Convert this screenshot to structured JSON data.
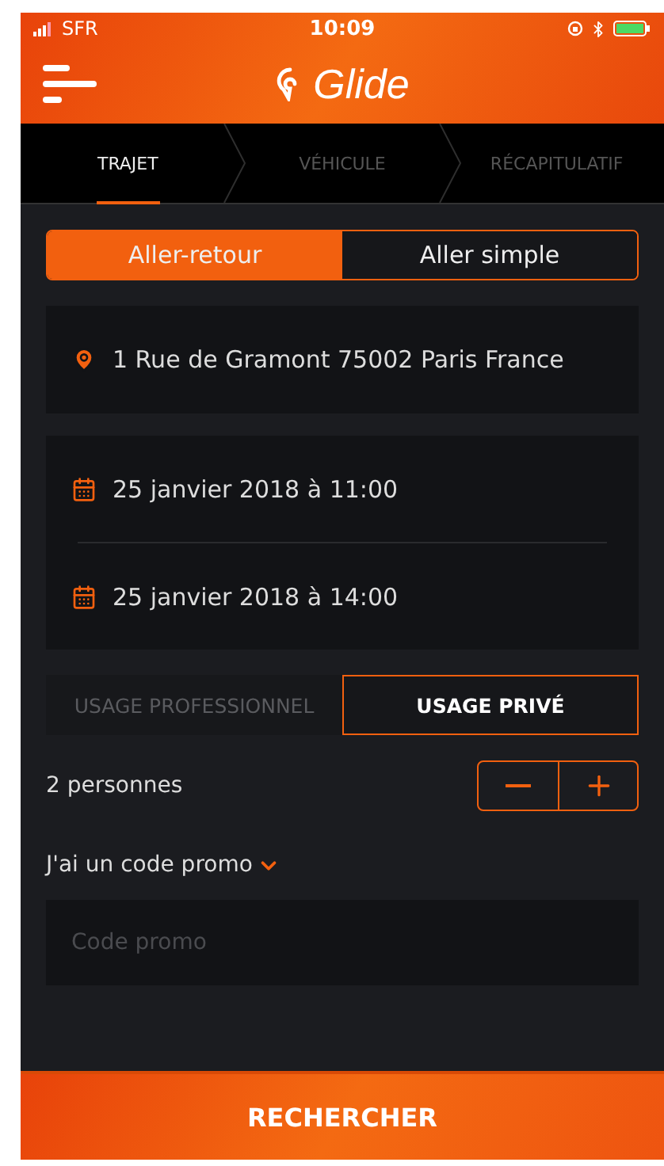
{
  "status_bar": {
    "carrier": "SFR",
    "time": "10:09"
  },
  "header": {
    "title": "Glide"
  },
  "steps": [
    {
      "label": "TRAJET",
      "selected": true
    },
    {
      "label": "VÉHICULE",
      "selected": false
    },
    {
      "label": "RÉCAPITULATIF",
      "selected": false
    }
  ],
  "trip_type": [
    {
      "label": "Aller-retour",
      "selected": true
    },
    {
      "label": "Aller simple",
      "selected": false
    }
  ],
  "address": "1 Rue de Gramont 75002 Paris France",
  "dates": [
    "25 janvier 2018 à 11:00",
    "25 janvier 2018 à 14:00"
  ],
  "usage": [
    {
      "label": "USAGE PROFESSIONNEL",
      "selected": false
    },
    {
      "label": "USAGE PRIVÉ",
      "selected": true
    }
  ],
  "passengers": {
    "label": "2 personnes"
  },
  "promo": {
    "label": "J'ai un code promo",
    "expanded": true,
    "placeholder": "Code promo"
  },
  "search_button": {
    "label": "RECHERCHER"
  }
}
